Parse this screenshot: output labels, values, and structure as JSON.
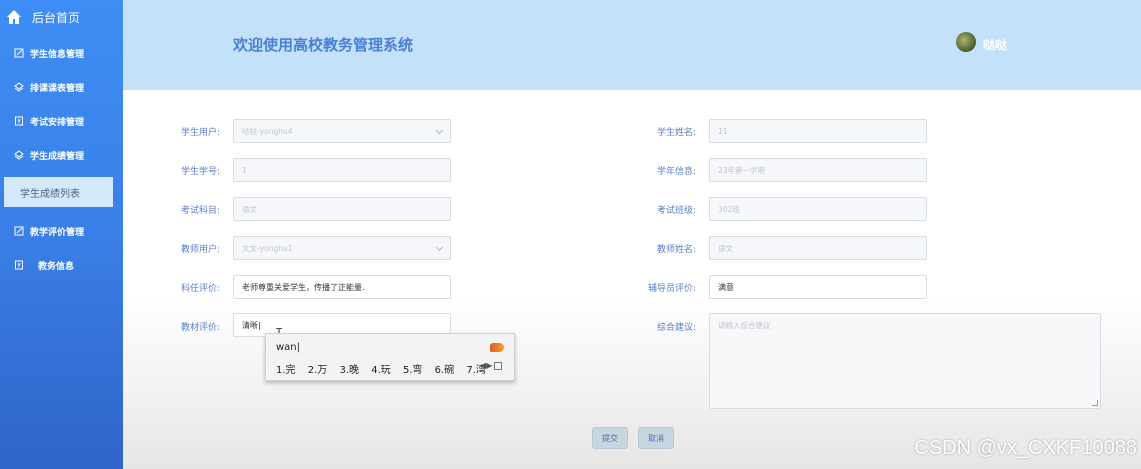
{
  "sidebar": {
    "home_label": "后台首页",
    "items": [
      {
        "label": "学生信息管理",
        "icon": "edit-icon"
      },
      {
        "label": "排课课表管理",
        "icon": "layers-icon"
      },
      {
        "label": "考试安排管理",
        "icon": "doc-icon"
      },
      {
        "label": "学生成绩管理",
        "icon": "layers-icon"
      },
      {
        "label": "教学评价管理",
        "icon": "edit-icon"
      },
      {
        "label": "教务信息",
        "icon": "doc-icon"
      }
    ],
    "active_sub": "学生成绩列表"
  },
  "header": {
    "title": "欢迎使用高校教务管理系统",
    "user_name": "哒哒"
  },
  "form": {
    "student_user": {
      "label": "学生用户:",
      "value": "哒哒-yonghu4"
    },
    "student_name": {
      "label": "学生姓名:",
      "value": "11"
    },
    "student_no": {
      "label": "学生学号:",
      "value": "1"
    },
    "school_year": {
      "label": "学年信息:",
      "value": "23年第一学期"
    },
    "exam_subject": {
      "label": "考试科目:",
      "value": "语文"
    },
    "exam_class": {
      "label": "考试班级:",
      "value": "302班"
    },
    "teacher_user": {
      "label": "教师用户:",
      "value": "文文-yonghu1"
    },
    "teacher_name": {
      "label": "教师姓名:",
      "value": "语文"
    },
    "subject_eval": {
      "label": "科任评价:",
      "value": "老师尊重关爱学生，传播了正能量."
    },
    "counselor_eval": {
      "label": "辅导员评价:",
      "value": "满意"
    },
    "textbook_eval": {
      "label": "教材评价:",
      "value": "清晰|"
    },
    "suggestion": {
      "label": "综合建议:",
      "placeholder": "请输入综合建议"
    },
    "submit_label": "提交",
    "cancel_label": "取消"
  },
  "ime": {
    "input": "wan|",
    "candidates": [
      "1.完",
      "2.万",
      "3.晚",
      "4.玩",
      "5.弯",
      "6.碗",
      "7.湾"
    ]
  },
  "watermark": "CSDN @vx_CXKF10088",
  "colors": {
    "sidebar": "#3a7fe6",
    "header_bg": "#c3e2f9",
    "label": "#5b7fc8",
    "title": "#4a7fd4"
  }
}
